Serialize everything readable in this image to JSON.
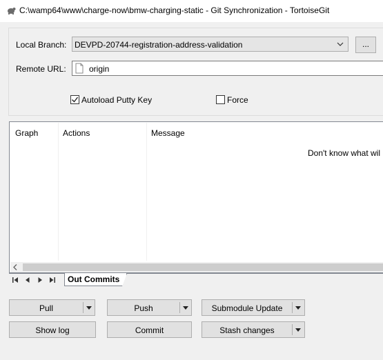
{
  "window": {
    "title": "C:\\wamp64\\www\\charge-now\\bmw-charging-static - Git Synchronization - TortoiseGit"
  },
  "form": {
    "local_branch_label": "Local Branch:",
    "local_branch_value": "DEVPD-20744-registration-address-validation",
    "browse_label": "...",
    "remote_url_label": "Remote URL:",
    "remote_url_value": "origin",
    "autoload_label": "Autoload Putty Key",
    "autoload_checked": true,
    "force_label": "Force",
    "force_checked": false
  },
  "commits": {
    "columns": [
      "Graph",
      "Actions",
      "Message"
    ],
    "empty_message": "Don't know what wil"
  },
  "tabs": {
    "active": "Out Commits"
  },
  "buttons": {
    "pull": "Pull",
    "push": "Push",
    "submodule_update": "Submodule Update",
    "show_log": "Show log",
    "commit": "Commit",
    "stash_changes": "Stash changes"
  }
}
